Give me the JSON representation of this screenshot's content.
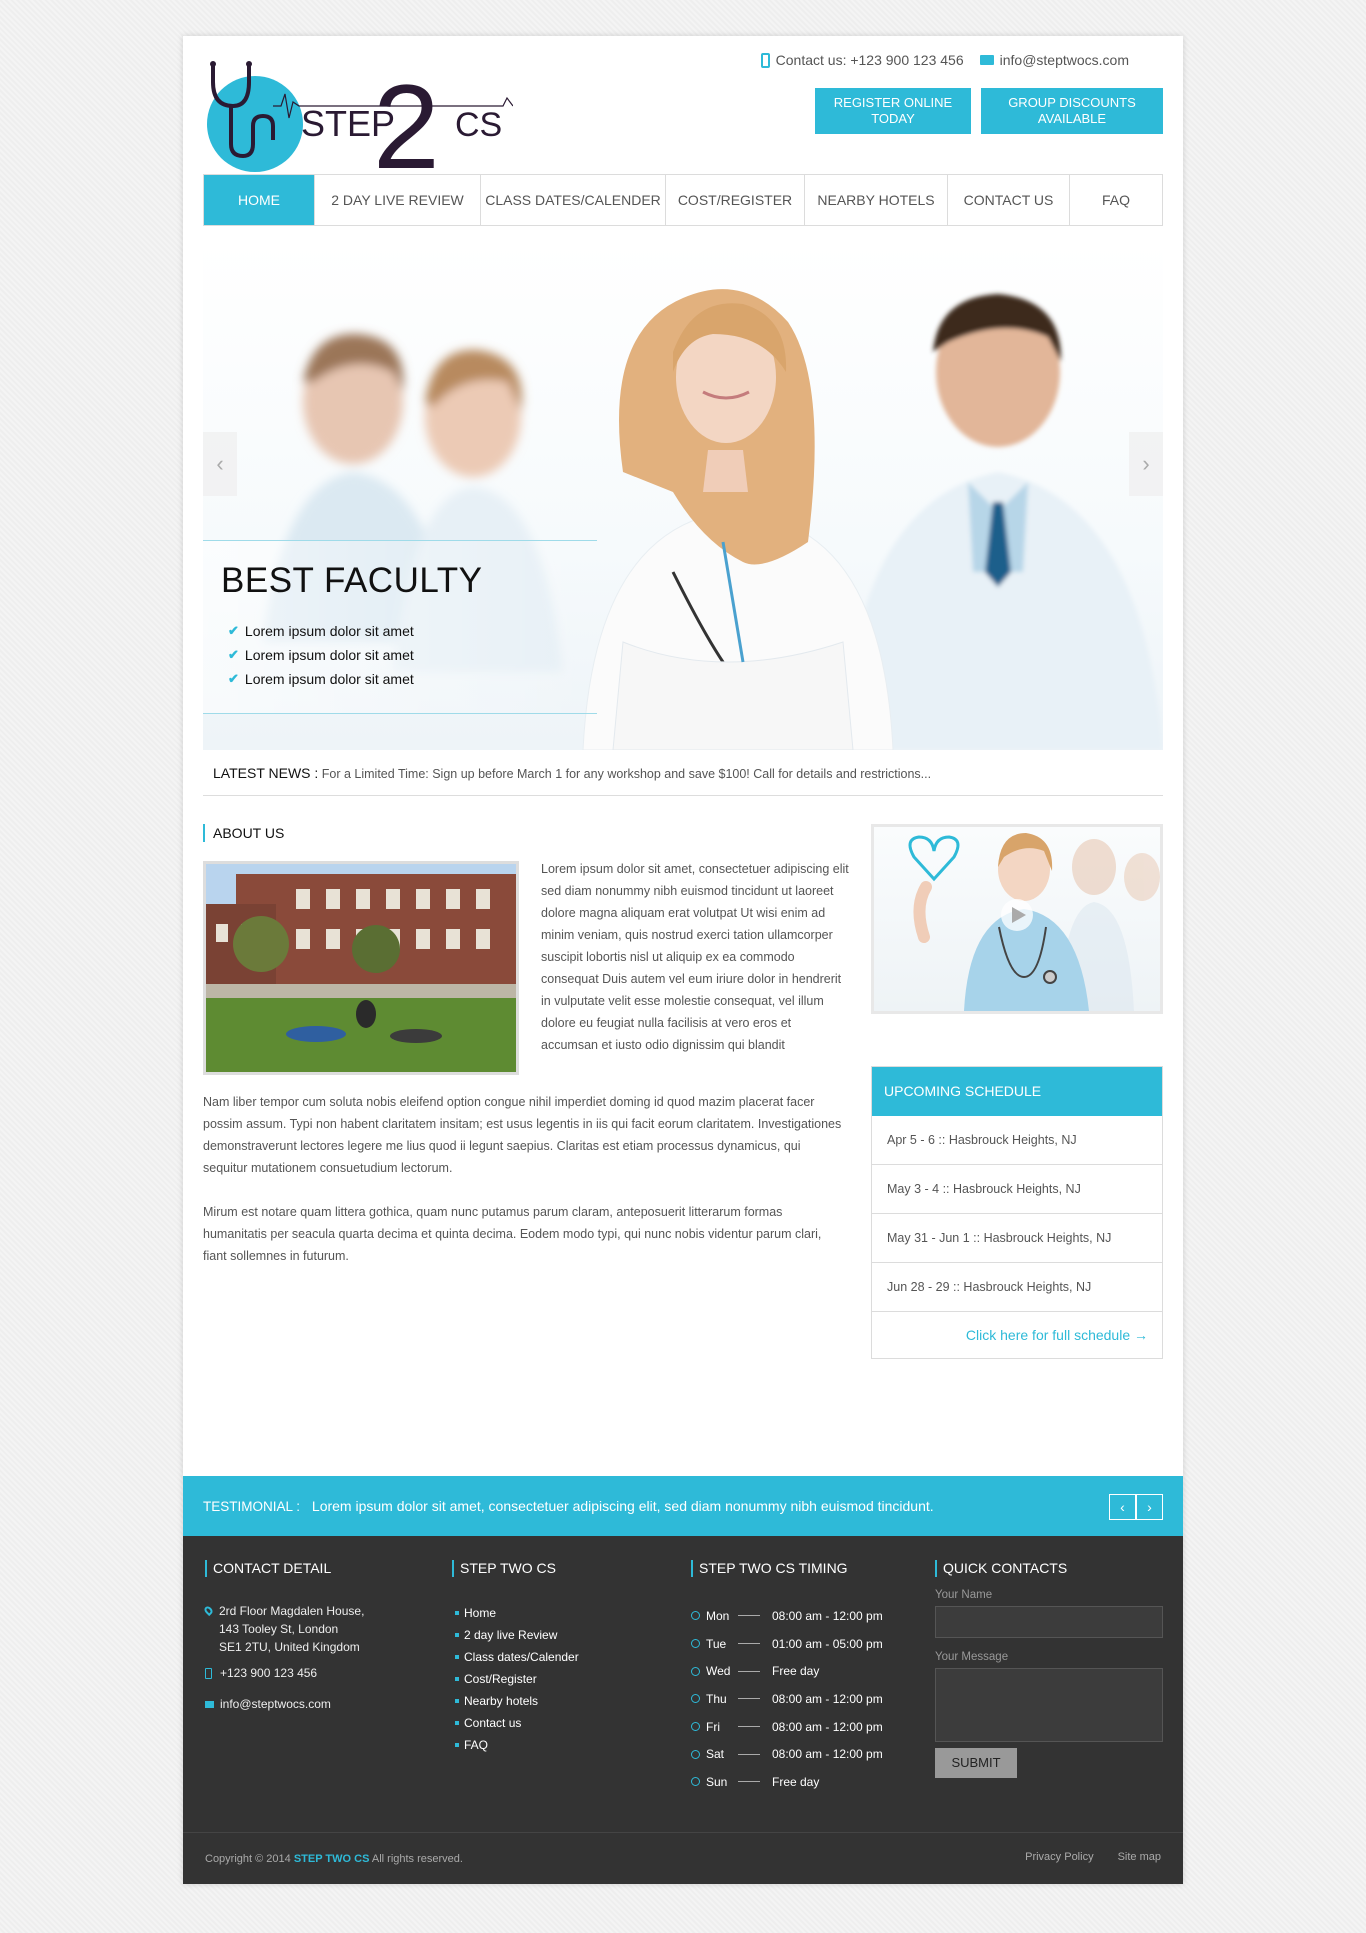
{
  "header": {
    "logo_text": "STEP2CS",
    "phone": "Contact us: +123 900 123 456",
    "email": "info@steptwocs.com",
    "cta_register": "REGISTER ONLINE TODAY",
    "cta_group": "GROUP DISCOUNTS AVAILABLE"
  },
  "nav": {
    "items": [
      {
        "label": "HOME"
      },
      {
        "label": "2 DAY LIVE REVIEW"
      },
      {
        "label": "CLASS DATES/CALENDER"
      },
      {
        "label": "COST/REGISTER"
      },
      {
        "label": "NEARBY HOTELS"
      },
      {
        "label": "CONTACT US"
      },
      {
        "label": "FAQ"
      }
    ]
  },
  "hero": {
    "title": "BEST FACULTY",
    "bullets": [
      "Lorem ipsum dolor sit amet",
      "Lorem ipsum dolor sit amet",
      "Lorem ipsum dolor sit amet"
    ],
    "prev": "‹",
    "next": "›"
  },
  "news": {
    "label": "LATEST NEWS :",
    "text": "For a Limited Time: Sign up before March 1 for any workshop and save $100! Call for details and restrictions..."
  },
  "about": {
    "title": "ABOUT US",
    "para1": "Lorem ipsum dolor sit amet, consectetuer adipiscing elit sed diam nonummy nibh euismod tincidunt ut laoreet dolore magna aliquam erat volutpat Ut wisi enim ad minim veniam, quis nostrud exerci tation ullamcorper suscipit lobortis nisl ut aliquip ex ea commodo consequat Duis autem vel eum iriure dolor in hendrerit in vulputate velit esse molestie consequat, vel illum dolore eu feugiat nulla facilisis at vero eros et accumsan et iusto odio dignissim qui blandit",
    "para2": "Nam liber tempor cum soluta nobis eleifend option congue nihil imperdiet doming id quod mazim placerat facer possim assum. Typi non habent claritatem insitam; est usus legentis in iis qui facit eorum claritatem. Investigationes demonstraverunt lectores legere me lius quod ii legunt saepius. Claritas est etiam processus dynamicus, qui sequitur mutationem consuetudium lectorum.",
    "para3": "Mirum est notare quam littera gothica, quam nunc putamus parum claram, anteposuerit litterarum formas humanitatis per seacula quarta decima et quinta decima. Eodem modo typi, qui nunc nobis videntur parum clari, fiant sollemnes in futurum."
  },
  "schedule": {
    "title": "UPCOMING SCHEDULE",
    "rows": [
      "Apr 5 - 6 :: Hasbrouck Heights, NJ",
      "May 3 - 4 :: Hasbrouck Heights, NJ",
      "May 31 - Jun 1 :: Hasbrouck Heights, NJ",
      "Jun 28 - 29 :: Hasbrouck Heights, NJ"
    ],
    "link": "Click here for full schedule →"
  },
  "testimonial": {
    "label": "TESTIMONIAL :",
    "text": "Lorem ipsum dolor sit amet, consectetuer adipiscing elit, sed diam nonummy nibh euismod tincidunt.",
    "prev": "‹",
    "next": "›"
  },
  "footer": {
    "contact_title": "CONTACT DETAIL",
    "address": [
      "2rd Floor Magdalen House,",
      "143 Tooley St, London",
      "SE1 2TU, United Kingdom"
    ],
    "phone": "+123 900 123 456",
    "email": "info@steptwocs.com",
    "links_title": "STEP TWO CS",
    "links": [
      "Home",
      "2 day live Review",
      "Class dates/Calender",
      "Cost/Register",
      "Nearby hotels",
      "Contact us",
      "FAQ"
    ],
    "timing_title": "STEP TWO CS TIMING",
    "timing": [
      {
        "day": "Mon",
        "hours": "08:00 am - 12:00 pm"
      },
      {
        "day": "Tue",
        "hours": "01:00 am - 05:00 pm"
      },
      {
        "day": "Wed",
        "hours": "Free day"
      },
      {
        "day": "Thu",
        "hours": "08:00 am - 12:00 pm"
      },
      {
        "day": "Fri",
        "hours": "08:00 am - 12:00 pm"
      },
      {
        "day": "Sat",
        "hours": "08:00 am - 12:00 pm"
      },
      {
        "day": "Sun",
        "hours": "Free day"
      }
    ],
    "quick_title": "QUICK CONTACTS",
    "name_label": "Your Name",
    "message_label": "Your Message",
    "submit": "SUBMIT",
    "copyright_pre": "Copyright © 2014",
    "copyright_brand": "STEP TWO CS",
    "copyright_post": "All rights reserved.",
    "privacy": "Privacy Policy",
    "sitemap": "Site map"
  },
  "colors": {
    "accent": "#2ebad8",
    "footer_bg": "#333333",
    "logo_dark": "#2a1a33"
  }
}
